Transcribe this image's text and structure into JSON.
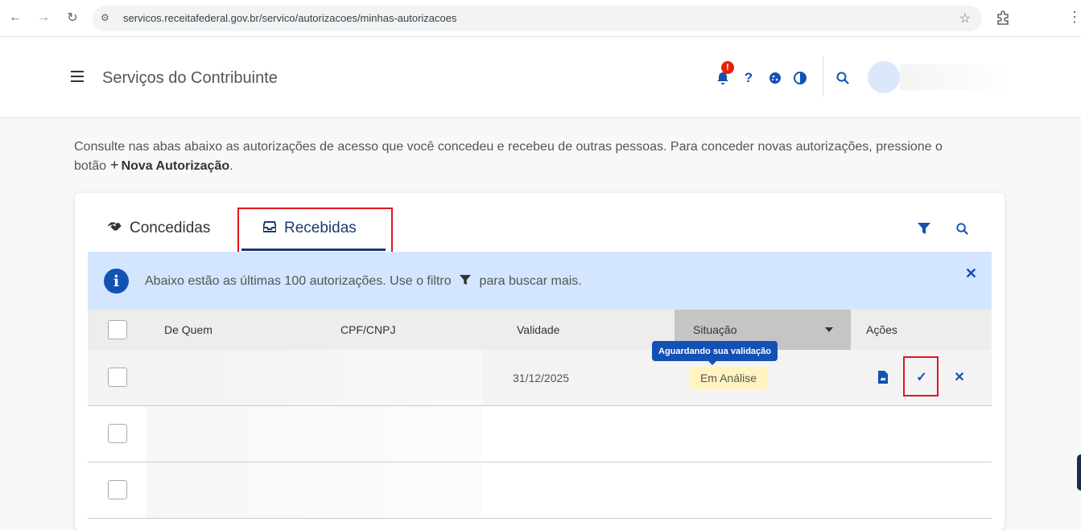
{
  "browser": {
    "url": "servicos.receitafederal.gov.br/servico/autorizacoes/minhas-autorizacoes"
  },
  "header": {
    "title": "Serviços do Contribuinte",
    "notification_count": "!",
    "help_label": "?"
  },
  "intro": {
    "text_before": "Consulte nas abas abaixo as autorizações de acesso que você concedeu e recebeu de outras pessoas. Para conceder novas autorizações, pressione o botão",
    "button_label": "Nova Autorização",
    "text_after": "."
  },
  "tabs": [
    {
      "label": "Concedidas",
      "active": false
    },
    {
      "label": "Recebidas",
      "active": true
    }
  ],
  "alert": {
    "text_before": "Abaixo estão as últimas 100 autorizações. Use o filtro",
    "text_after": "para buscar mais."
  },
  "table": {
    "columns": [
      "De Quem",
      "CPF/CNPJ",
      "Validade",
      "Situação",
      "Ações"
    ],
    "sorted_column": "Situação",
    "rows": [
      {
        "de_quem": "",
        "cpf_cnpj": "",
        "validade": "31/12/2025",
        "situacao": "Em Análise",
        "tooltip": "Aguardando sua validação"
      },
      {
        "de_quem": "",
        "cpf_cnpj": "",
        "validade": "",
        "situacao": ""
      },
      {
        "de_quem": "",
        "cpf_cnpj": "",
        "validade": "",
        "situacao": ""
      }
    ]
  },
  "colors": {
    "primary": "#1351b4",
    "tab_active": "#1c3b6e",
    "alert_bg": "#d4e5ff",
    "status_bg": "#fff3c2",
    "highlight_box": "#e3141f"
  }
}
